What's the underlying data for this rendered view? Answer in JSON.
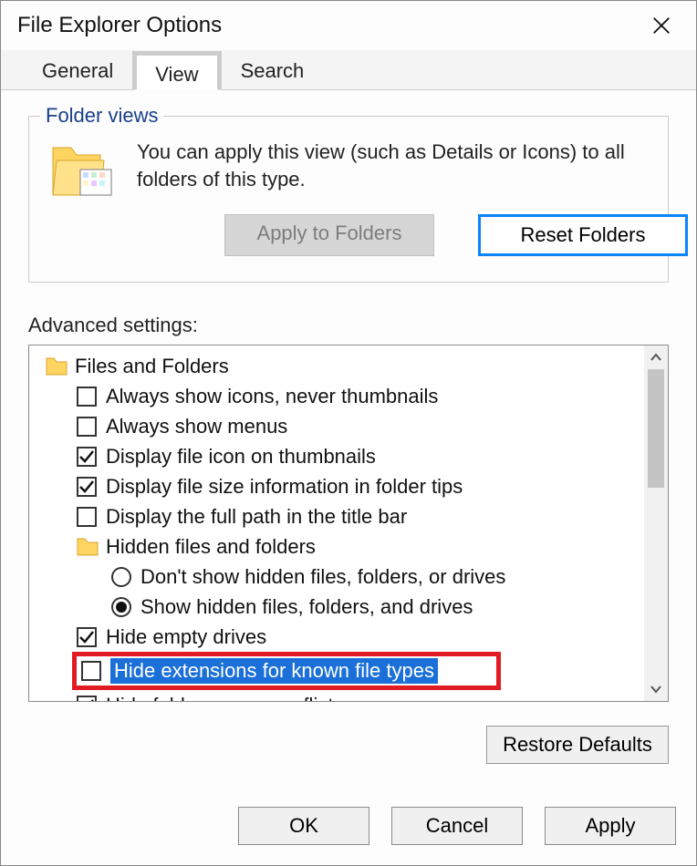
{
  "window": {
    "title": "File Explorer Options"
  },
  "tabs": {
    "general": "General",
    "view": "View",
    "search": "Search",
    "active": "view"
  },
  "folder_views": {
    "group_title": "Folder views",
    "description": "You can apply this view (such as Details or Icons) to all folders of this type.",
    "apply_btn": "Apply to Folders",
    "reset_btn": "Reset Folders"
  },
  "advanced": {
    "label": "Advanced settings:",
    "root": "Files and Folders",
    "items": [
      {
        "type": "check",
        "checked": false,
        "label": "Always show icons, never thumbnails"
      },
      {
        "type": "check",
        "checked": false,
        "label": "Always show menus"
      },
      {
        "type": "check",
        "checked": true,
        "label": "Display file icon on thumbnails"
      },
      {
        "type": "check",
        "checked": true,
        "label": "Display file size information in folder tips"
      },
      {
        "type": "check",
        "checked": false,
        "label": "Display the full path in the title bar"
      },
      {
        "type": "folder",
        "label": "Hidden files and folders"
      },
      {
        "type": "radio",
        "selected": false,
        "label": "Don't show hidden files, folders, or drives"
      },
      {
        "type": "radio",
        "selected": true,
        "label": "Show hidden files, folders, and drives"
      },
      {
        "type": "check",
        "checked": true,
        "label": "Hide empty drives"
      },
      {
        "type": "check",
        "checked": false,
        "label": "Hide extensions for known file types",
        "selected_row": true
      },
      {
        "type": "check",
        "checked": true,
        "label": "Hide folder merge conflicts"
      }
    ],
    "restore_btn": "Restore Defaults"
  },
  "dialog": {
    "ok": "OK",
    "cancel": "Cancel",
    "apply": "Apply"
  }
}
